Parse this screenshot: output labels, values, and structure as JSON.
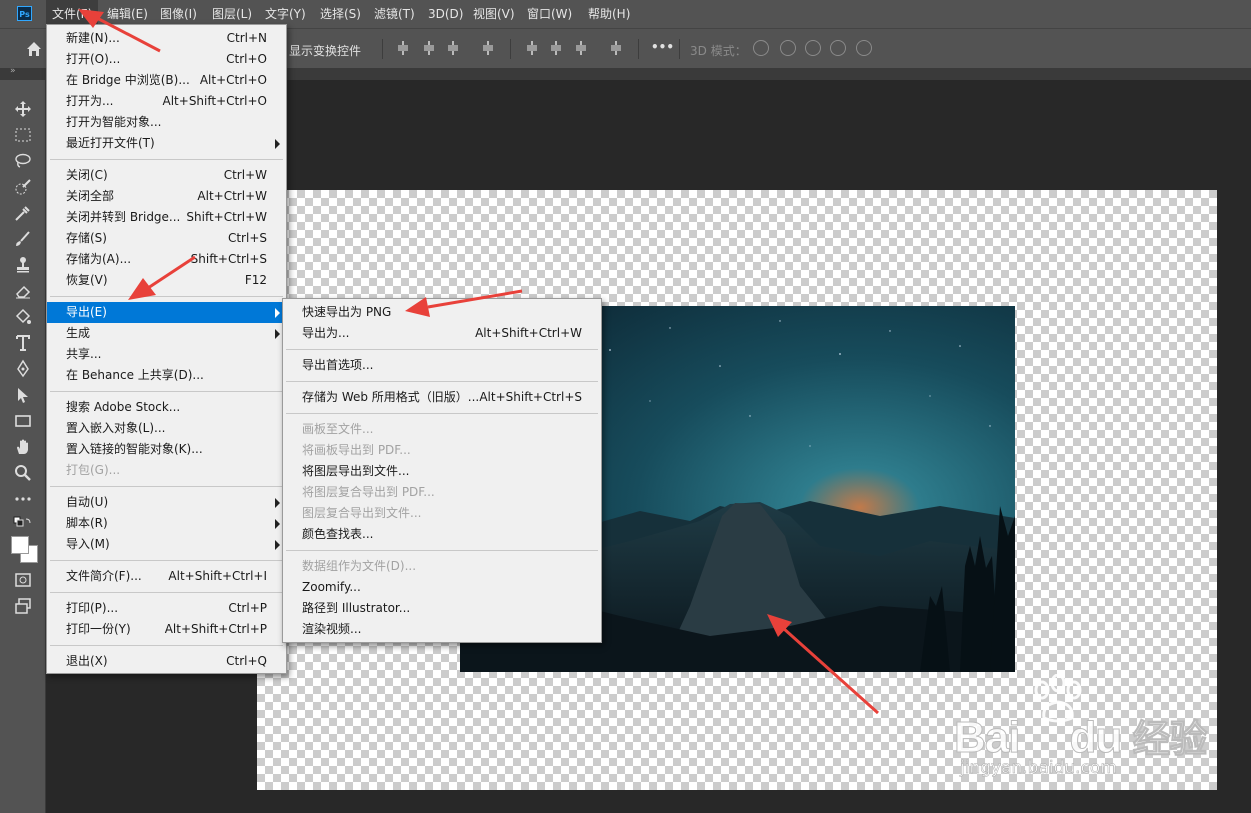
{
  "app": {
    "logo": "Ps"
  },
  "menubar": [
    {
      "label": "文件(F)",
      "active": true
    },
    {
      "label": "编辑(E)"
    },
    {
      "label": "图像(I)"
    },
    {
      "label": "图层(L)"
    },
    {
      "label": "文字(Y)"
    },
    {
      "label": "选择(S)"
    },
    {
      "label": "滤镜(T)"
    },
    {
      "label": "3D(D)"
    },
    {
      "label": "视图(V)"
    },
    {
      "label": "窗口(W)"
    },
    {
      "label": "帮助(H)"
    }
  ],
  "options_bar": {
    "show_transform_controls": "显示变换控件",
    "more": "•••",
    "mode_3d_label": "3D 模式："
  },
  "file_menu": {
    "groups": [
      [
        {
          "label": "新建(N)...",
          "shortcut": "Ctrl+N"
        },
        {
          "label": "打开(O)...",
          "shortcut": "Ctrl+O"
        },
        {
          "label": "在 Bridge 中浏览(B)...",
          "shortcut": "Alt+Ctrl+O"
        },
        {
          "label": "打开为...",
          "shortcut": "Alt+Shift+Ctrl+O"
        },
        {
          "label": "打开为智能对象..."
        },
        {
          "label": "最近打开文件(T)",
          "submenu": true
        }
      ],
      [
        {
          "label": "关闭(C)",
          "shortcut": "Ctrl+W"
        },
        {
          "label": "关闭全部",
          "shortcut": "Alt+Ctrl+W"
        },
        {
          "label": "关闭并转到 Bridge...",
          "shortcut": "Shift+Ctrl+W"
        },
        {
          "label": "存储(S)",
          "shortcut": "Ctrl+S"
        },
        {
          "label": "存储为(A)...",
          "shortcut": "Shift+Ctrl+S"
        },
        {
          "label": "恢复(V)",
          "shortcut": "F12"
        }
      ],
      [
        {
          "label": "导出(E)",
          "submenu": true,
          "highlighted": true
        },
        {
          "label": "生成",
          "submenu": true
        },
        {
          "label": "共享..."
        },
        {
          "label": "在 Behance 上共享(D)..."
        }
      ],
      [
        {
          "label": "搜索 Adobe Stock..."
        },
        {
          "label": "置入嵌入对象(L)..."
        },
        {
          "label": "置入链接的智能对象(K)..."
        },
        {
          "label": "打包(G)...",
          "disabled": true
        }
      ],
      [
        {
          "label": "自动(U)",
          "submenu": true
        },
        {
          "label": "脚本(R)",
          "submenu": true
        },
        {
          "label": "导入(M)",
          "submenu": true
        }
      ],
      [
        {
          "label": "文件简介(F)...",
          "shortcut": "Alt+Shift+Ctrl+I"
        }
      ],
      [
        {
          "label": "打印(P)...",
          "shortcut": "Ctrl+P"
        },
        {
          "label": "打印一份(Y)",
          "shortcut": "Alt+Shift+Ctrl+P"
        }
      ],
      [
        {
          "label": "退出(X)",
          "shortcut": "Ctrl+Q"
        }
      ]
    ]
  },
  "export_menu": {
    "groups": [
      [
        {
          "label": "快速导出为 PNG"
        },
        {
          "label": "导出为...",
          "shortcut": "Alt+Shift+Ctrl+W"
        }
      ],
      [
        {
          "label": "导出首选项..."
        }
      ],
      [
        {
          "label": "存储为 Web 所用格式（旧版）...",
          "shortcut": "Alt+Shift+Ctrl+S"
        }
      ],
      [
        {
          "label": "画板至文件...",
          "disabled": true
        },
        {
          "label": "将画板导出到 PDF...",
          "disabled": true
        },
        {
          "label": "将图层导出到文件..."
        },
        {
          "label": "将图层复合导出到 PDF...",
          "disabled": true
        },
        {
          "label": "图层复合导出到文件...",
          "disabled": true
        },
        {
          "label": "颜色查找表..."
        }
      ],
      [
        {
          "label": "数据组作为文件(D)...",
          "disabled": true
        },
        {
          "label": "Zoomify..."
        },
        {
          "label": "路径到 Illustrator..."
        },
        {
          "label": "渲染视频..."
        }
      ]
    ]
  },
  "watermark": {
    "brand": "Bai",
    "brand2": "du",
    "cn": "经验",
    "url": "jingyan.baidu.com"
  },
  "colors": {
    "menubar": "#535353",
    "highlight": "#0078d7",
    "menu_bg": "#f0f0f0",
    "arrow": "#e8413a",
    "workspace": "#282828"
  }
}
